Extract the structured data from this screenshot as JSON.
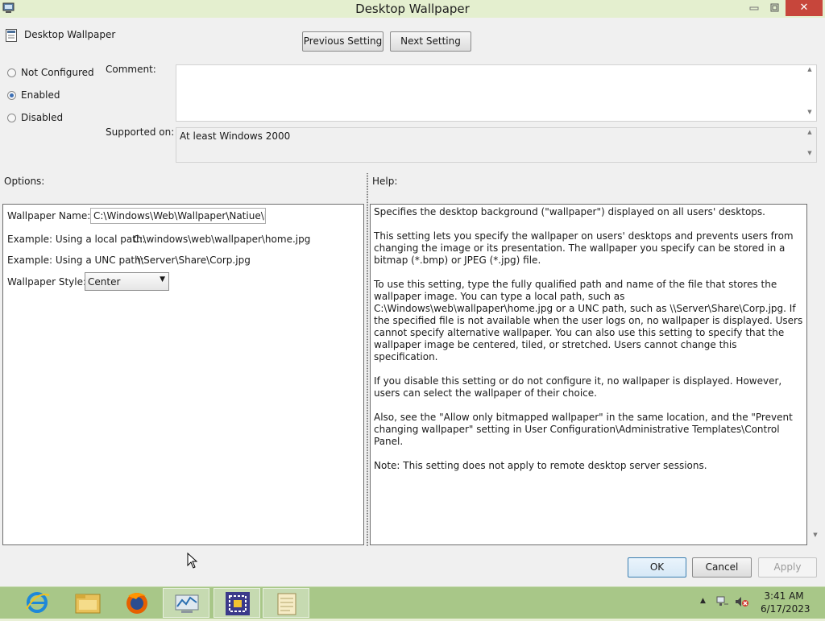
{
  "window": {
    "title": "Desktop Wallpaper",
    "close_glyph": "✕"
  },
  "header": {
    "setting_name": "Desktop Wallpaper",
    "prev_button": "Previous Setting",
    "next_button": "Next Setting"
  },
  "state": {
    "options": [
      {
        "label": "Not Configured",
        "selected": false
      },
      {
        "label": "Enabled",
        "selected": true
      },
      {
        "label": "Disabled",
        "selected": false
      }
    ]
  },
  "comment": {
    "label": "Comment:",
    "value": ""
  },
  "supported": {
    "label": "Supported on:",
    "value": "At least Windows 2000"
  },
  "options_panel": {
    "label": "Options:",
    "wallpaper_name_label": "Wallpaper Name:",
    "wallpaper_name_value": "C:\\Windows\\Web\\Wallpaper\\Natiue\\img",
    "local_example_label": "Example: Using a local path:",
    "local_example_value": "C:\\windows\\web\\wallpaper\\home.jpg",
    "unc_example_label": "Example: Using a UNC path:",
    "unc_example_value": "\\\\Server\\Share\\Corp.jpg",
    "style_label": "Wallpaper Style:",
    "style_value": "Center"
  },
  "help_panel": {
    "label": "Help:",
    "paragraphs": [
      "Specifies the desktop background (\"wallpaper\") displayed on all users' desktops.",
      "This setting lets you specify the wallpaper on users' desktops and prevents users from changing the image or its presentation. The wallpaper you specify can be stored in a bitmap (*.bmp) or JPEG (*.jpg) file.",
      "To use this setting, type the fully qualified path and name of the file that stores the wallpaper image. You can type a local path, such as C:\\Windows\\web\\wallpaper\\home.jpg or a UNC path, such as \\\\Server\\Share\\Corp.jpg. If the specified file is not available when the user logs on, no wallpaper is displayed. Users cannot specify alternative wallpaper. You can also use this setting to specify that the wallpaper image be centered, tiled, or stretched. Users cannot change this specification.",
      "If you disable this setting or do not configure it, no wallpaper is displayed. However, users can select the wallpaper of their choice.",
      "Also, see the \"Allow only bitmapped wallpaper\" in the same location, and the \"Prevent changing wallpaper\" setting in User Configuration\\Administrative Templates\\Control Panel.",
      "Note: This setting does not apply to remote desktop server sessions."
    ]
  },
  "footer": {
    "ok": "OK",
    "cancel": "Cancel",
    "apply": "Apply"
  },
  "taskbar": {
    "items": [
      "internet-explorer-icon",
      "file-explorer-icon",
      "firefox-icon",
      "performance-monitor-icon",
      "group-policy-editor-icon",
      "notepad-icon"
    ],
    "clock_time": "3:41 AM",
    "clock_date": "6/17/2023"
  },
  "colors": {
    "taskbar": "#a8c788",
    "titlebar": "#e4efcf",
    "close_button": "#c7463b",
    "radio_selected": "#3c6fb5"
  }
}
